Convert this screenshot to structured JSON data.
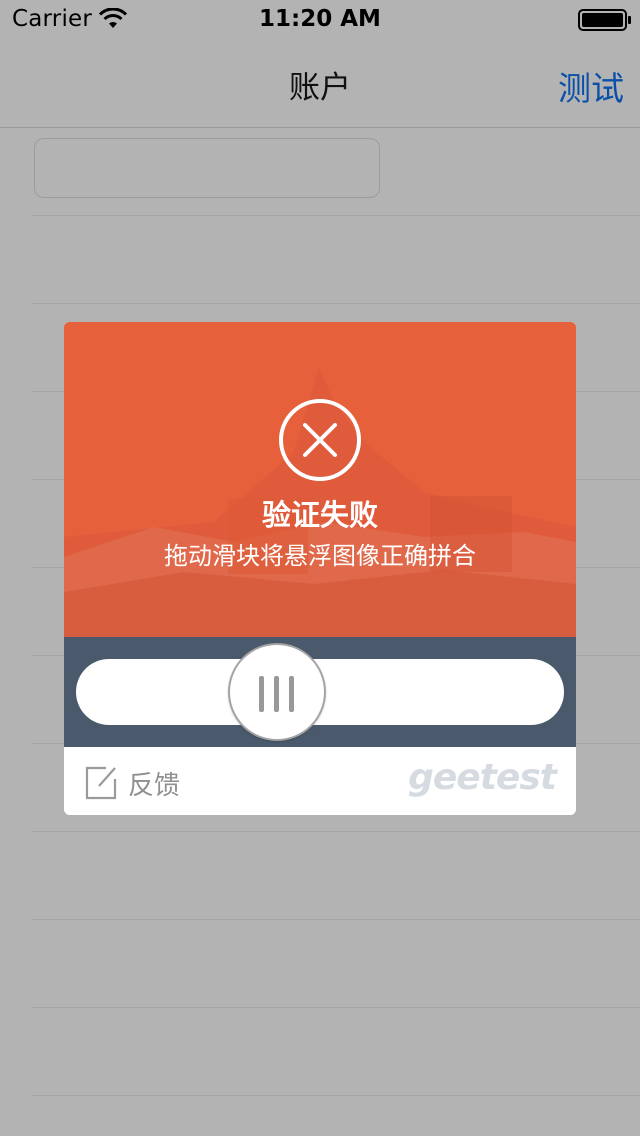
{
  "status_bar": {
    "carrier": "Carrier",
    "time": "11:20 AM"
  },
  "nav": {
    "title": "账户",
    "right_button": "测试"
  },
  "captcha": {
    "title": "验证失败",
    "message": "拖动滑块将悬浮图像正确拼合",
    "feedback_label": "反馈",
    "brand": "geetest",
    "accent_color": "#e6603c",
    "slider_bg_color": "#4a5a6c"
  }
}
